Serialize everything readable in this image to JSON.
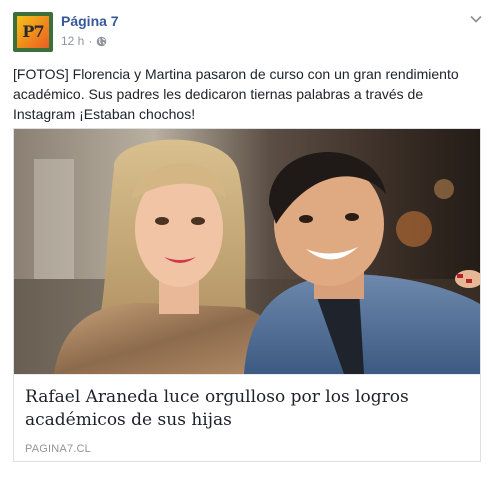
{
  "page": {
    "name": "Página 7",
    "avatar_text": "P7",
    "timestamp": "12 h",
    "separator": "·",
    "audience_icon": "globe-icon",
    "menu_icon": "chevron-down-icon"
  },
  "post": {
    "text": "[FOTOS] Florencia y Martina pasaron de curso con un gran rendimiento académico. Sus padres les dedicaron tiernas palabras a través de Instagram ¡Estaban chochos!"
  },
  "link_card": {
    "title": "Rafael Araneda luce orgulloso por los logros académicos de sus hijas",
    "domain": "PAGINA7.CL"
  },
  "colors": {
    "page_name": "#365899",
    "meta": "#90949c",
    "text": "#1d2129",
    "border": "#dddfe2"
  }
}
